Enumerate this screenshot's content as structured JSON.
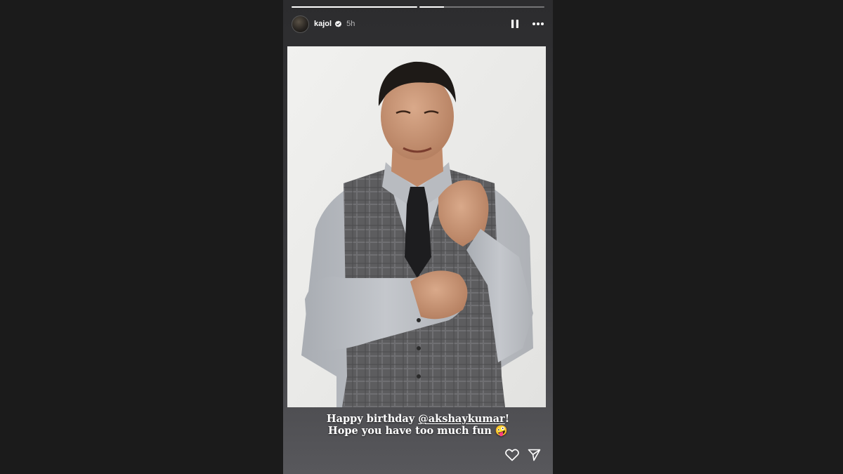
{
  "story": {
    "progress": [
      {
        "fill_fraction": 1.0
      },
      {
        "fill_fraction": 0.2
      }
    ],
    "header": {
      "username": "kajol",
      "verified": true,
      "time_ago": "5h",
      "icons": [
        "pause-icon",
        "more-options-icon"
      ]
    },
    "photo": {
      "background_color": "#ececea"
    },
    "caption": {
      "line1_prefix": "Happy birthday ",
      "mention": "@akshaykumar",
      "line1_suffix": "!",
      "line2_text": "Hope you have too much fun ",
      "line2_emoji": "🤪"
    },
    "footer": {
      "icons": [
        "heart-icon",
        "send-icon"
      ]
    }
  },
  "colors": {
    "page_background": "#1b1b1b",
    "story_background": "#2c2c2e",
    "text": "#ffffff",
    "verified_badge": "#ffffff"
  }
}
